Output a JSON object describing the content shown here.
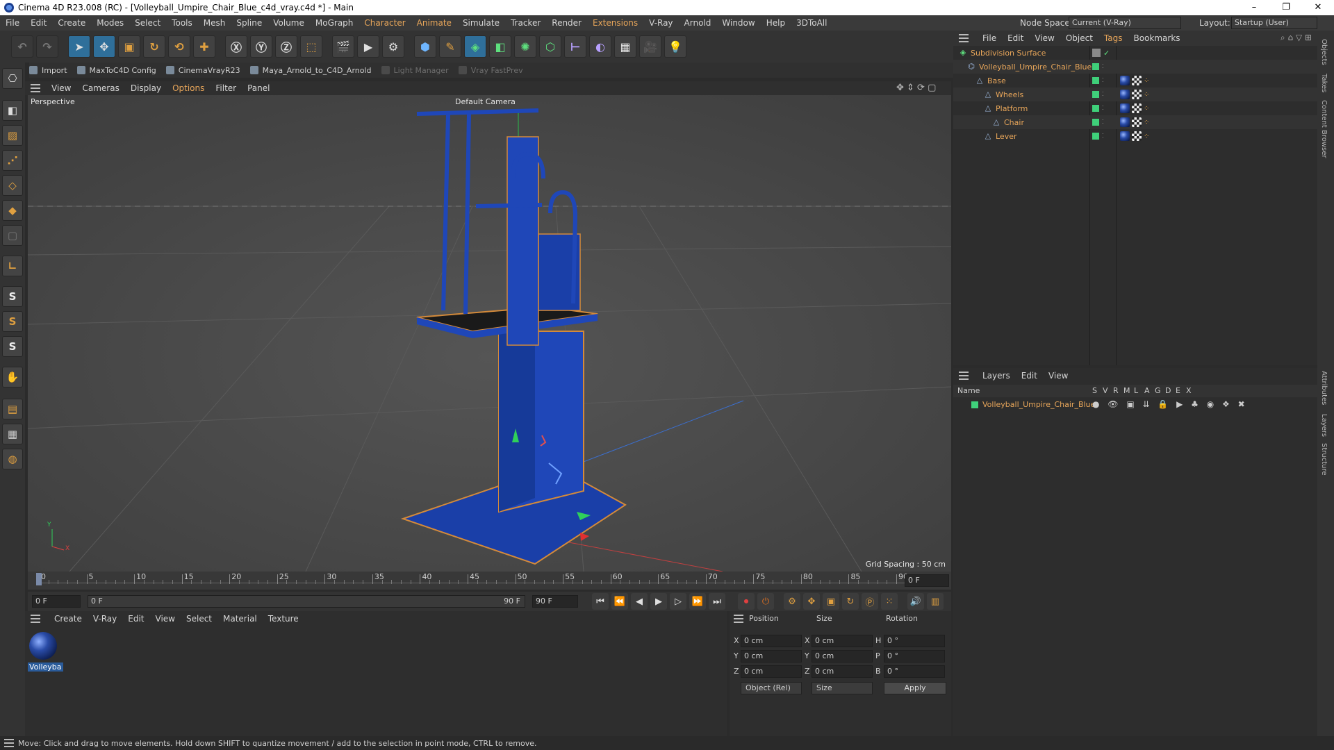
{
  "window": {
    "title": "Cinema 4D R23.008 (RC) - [Volleyball_Umpire_Chair_Blue_c4d_vray.c4d *] - Main",
    "minimize": "–",
    "restore": "❐",
    "close": "✕"
  },
  "menu": {
    "items": [
      "File",
      "Edit",
      "Create",
      "Modes",
      "Select",
      "Tools",
      "Mesh",
      "Spline",
      "Volume",
      "MoGraph",
      "Character",
      "Animate",
      "Simulate",
      "Tracker",
      "Render",
      "Extensions",
      "V-Ray",
      "Arnold",
      "Window",
      "Help",
      "3DToAll"
    ],
    "node_space_label": "Node Space:",
    "node_space_value": "Current (V-Ray)",
    "layout_label": "Layout:",
    "layout_value": "Startup (User)"
  },
  "plugins": {
    "items": [
      "Import",
      "MaxToC4D Config",
      "CinemaVrayR23",
      "Maya_Arnold_to_C4D_Arnold",
      "Light Manager",
      "Vray FastPrev"
    ]
  },
  "viewport_menu": {
    "items": [
      "View",
      "Cameras",
      "Display",
      "Options",
      "Filter",
      "Panel"
    ]
  },
  "viewport": {
    "mode_label": "Perspective",
    "camera_label": "Default Camera",
    "grid_spacing": "Grid Spacing : 50 cm",
    "axis_y": "Y",
    "axis_x": "X"
  },
  "timeline": {
    "ticks": [
      "0",
      "5",
      "10",
      "15",
      "20",
      "25",
      "30",
      "35",
      "40",
      "45",
      "50",
      "55",
      "60",
      "65",
      "70",
      "75",
      "80",
      "85",
      "90"
    ],
    "current_frame_field": "0 F"
  },
  "playbar": {
    "start_field": "0 F",
    "range_start": "0 F",
    "range_end": "90 F",
    "end_field": "90 F"
  },
  "material_panel": {
    "menu": [
      "Create",
      "V-Ray",
      "Edit",
      "View",
      "Select",
      "Material",
      "Texture"
    ],
    "material_name": "Volleyba"
  },
  "attributes": {
    "headers": {
      "position": "Position",
      "size": "Size",
      "rotation": "Rotation"
    },
    "rows": [
      {
        "axis": "X",
        "pos": "0 cm",
        "size_axis": "X",
        "size": "0 cm",
        "rot_axis": "H",
        "rot": "0 °"
      },
      {
        "axis": "Y",
        "pos": "0 cm",
        "size_axis": "Y",
        "size": "0 cm",
        "rot_axis": "P",
        "rot": "0 °"
      },
      {
        "axis": "Z",
        "pos": "0 cm",
        "size_axis": "Z",
        "size": "0 cm",
        "rot_axis": "B",
        "rot": "0 °"
      }
    ],
    "coord_mode": "Object (Rel)",
    "size_mode": "Size",
    "apply": "Apply"
  },
  "objects_panel": {
    "menu": [
      "File",
      "Edit",
      "View",
      "Object",
      "Tags",
      "Bookmarks"
    ],
    "tree": [
      {
        "name": "Subdivision Surface",
        "indent": 0,
        "icon": "subdivision-icon",
        "check": "✓"
      },
      {
        "name": "Volleyball_Umpire_Chair_Blue",
        "indent": 1,
        "icon": "null-icon"
      },
      {
        "name": "Base",
        "indent": 2,
        "icon": "polygon-icon"
      },
      {
        "name": "Wheels",
        "indent": 3,
        "icon": "polygon-icon"
      },
      {
        "name": "Platform",
        "indent": 3,
        "icon": "polygon-icon"
      },
      {
        "name": "Chair",
        "indent": 4,
        "icon": "polygon-icon"
      },
      {
        "name": "Lever",
        "indent": 3,
        "icon": "polygon-icon"
      }
    ]
  },
  "layers_panel": {
    "menu": [
      "Layers",
      "Edit",
      "View"
    ],
    "name_header": "Name",
    "columns": [
      "S",
      "V",
      "R",
      "M",
      "L",
      "A",
      "G",
      "D",
      "E",
      "X"
    ],
    "layers": [
      {
        "name": "Volleyball_Umpire_Chair_Blue",
        "color": "#3fd07a"
      }
    ]
  },
  "side_tabs": [
    "Objects",
    "Takes",
    "Content Browser",
    "Attributes",
    "Layers",
    "Structure"
  ],
  "status": {
    "text": "Move: Click and drag to move elements. Hold down SHIFT to quantize movement / add to the selection in point mode, CTRL to remove."
  },
  "colors": {
    "accent": "#e8a65a",
    "layer_green": "#3fd07a",
    "model_blue": "#1a3fa8",
    "selection_orange": "#d48a3a"
  }
}
